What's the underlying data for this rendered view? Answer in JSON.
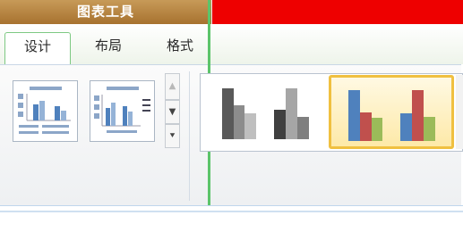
{
  "contextual_tab_header": "图表工具",
  "tabs": [
    {
      "label": "设计",
      "active": true
    },
    {
      "label": "布局",
      "active": false
    },
    {
      "label": "格式",
      "active": false
    }
  ],
  "gallery_scroll": {
    "up": "▲",
    "down": "▼",
    "more": "⯆"
  },
  "chart_styles": [
    {
      "name": "grayscale-1",
      "selected": false,
      "colors": [
        "#595959",
        "#8c8c8c",
        "#bfbfbf"
      ]
    },
    {
      "name": "grayscale-2",
      "selected": false,
      "colors": [
        "#404040",
        "#a6a6a6",
        "#7f7f7f"
      ]
    },
    {
      "name": "colorful-1",
      "selected": true,
      "colors": [
        "#4f81bd",
        "#c0504d",
        "#9bbb59"
      ]
    },
    {
      "name": "colorful-2",
      "selected": false,
      "colors": [
        "#4f81bd",
        "#c0504d",
        "#9bbb59"
      ]
    }
  ],
  "colors": {
    "accent_green": "#5cc46a",
    "header_gold": "#b07d3a",
    "red_bar": "#ee0000",
    "selection": "#f0c040"
  }
}
